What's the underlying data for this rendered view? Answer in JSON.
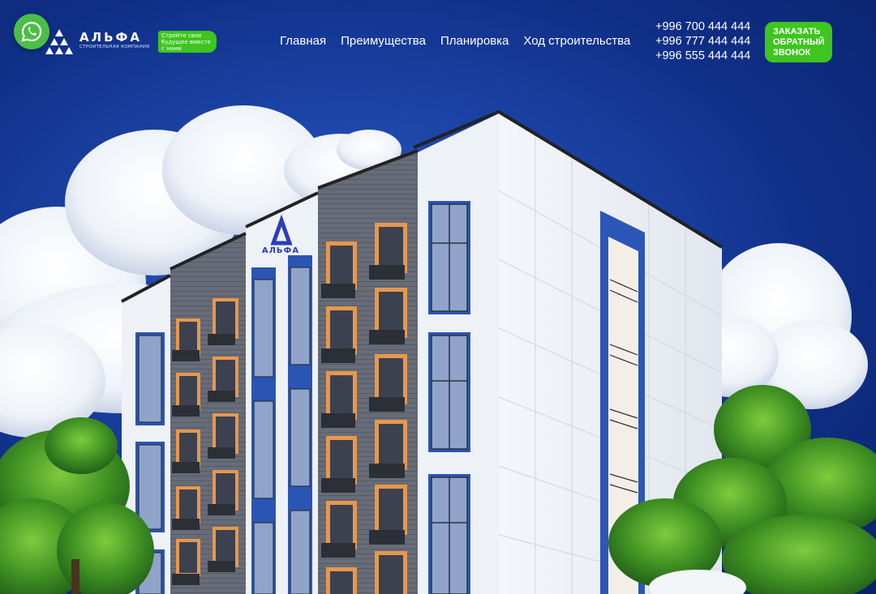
{
  "header": {
    "logo": {
      "name": "АЛЬФА",
      "subtitle": "СТРОИТЕЛЬНАЯ КОМПАНИЯ"
    },
    "slogan": [
      "Стройте свое",
      "будущее вместе",
      "с нами"
    ],
    "nav": [
      {
        "label": "Главная"
      },
      {
        "label": "Преимущества"
      },
      {
        "label": "Планировка"
      },
      {
        "label": "Ход строительства"
      }
    ],
    "phones": [
      "+996 700 444 444",
      "+996 777 444 444",
      "+996 555 444 444"
    ],
    "callback": [
      "ЗАКАЗАТЬ",
      "ОБРАТНЫЙ",
      "ЗВОНОК"
    ]
  },
  "building": {
    "sign": "АЛЬФА"
  },
  "colors": {
    "accent_green": "#3ec51f",
    "whatsapp": "#4bbf45",
    "sky": "#1b43a6",
    "brand_blue": "#2a52c9"
  }
}
